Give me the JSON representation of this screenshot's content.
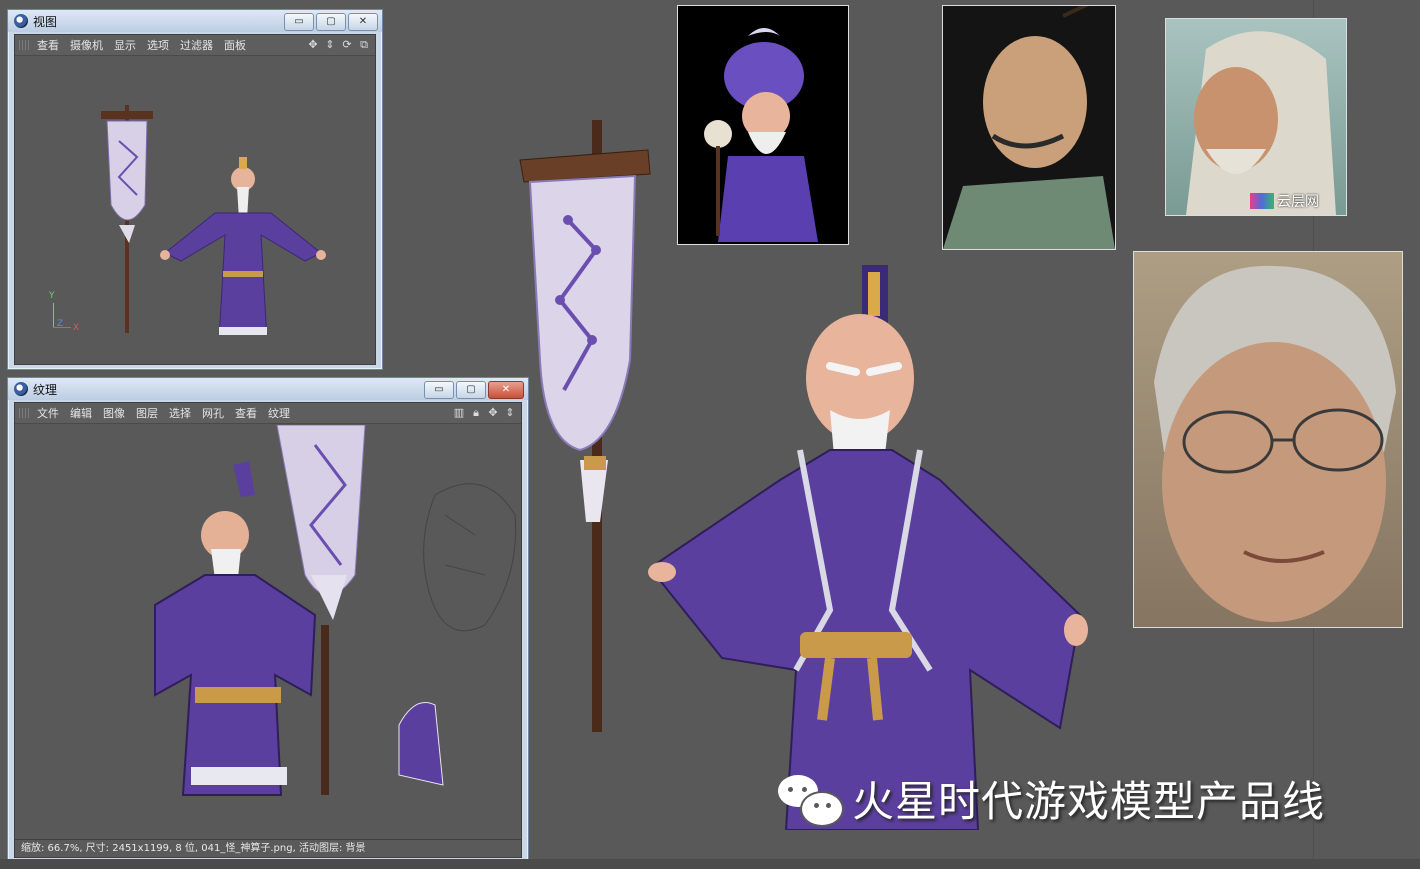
{
  "view_window": {
    "title": "视图",
    "menu": [
      "查看",
      "摄像机",
      "显示",
      "选项",
      "过滤器",
      "面板"
    ],
    "axis_labels": {
      "y": "Y",
      "z": "Z",
      "x": "X"
    }
  },
  "texture_window": {
    "title": "纹理",
    "menu": [
      "文件",
      "编辑",
      "图像",
      "图层",
      "选择",
      "网孔",
      "查看",
      "纹理"
    ],
    "status": "缩放: 66.7%, 尺寸: 2451x1199, 8 位, 041_怪_神算子.png, 活动图层: 背景"
  },
  "window_buttons": {
    "minimize": "▭",
    "maximize": "▢",
    "close": "✕"
  },
  "references": {
    "photo_watermark": "云层网"
  },
  "watermark": {
    "text": "火星时代游戏模型产品线"
  },
  "colors": {
    "robe": "#5b3f9e",
    "robe_dark": "#3f2a78",
    "banner": "#d9d2e8",
    "belt": "#c99a4a",
    "background": "#595959",
    "title_bar": "#c9d7e8"
  }
}
